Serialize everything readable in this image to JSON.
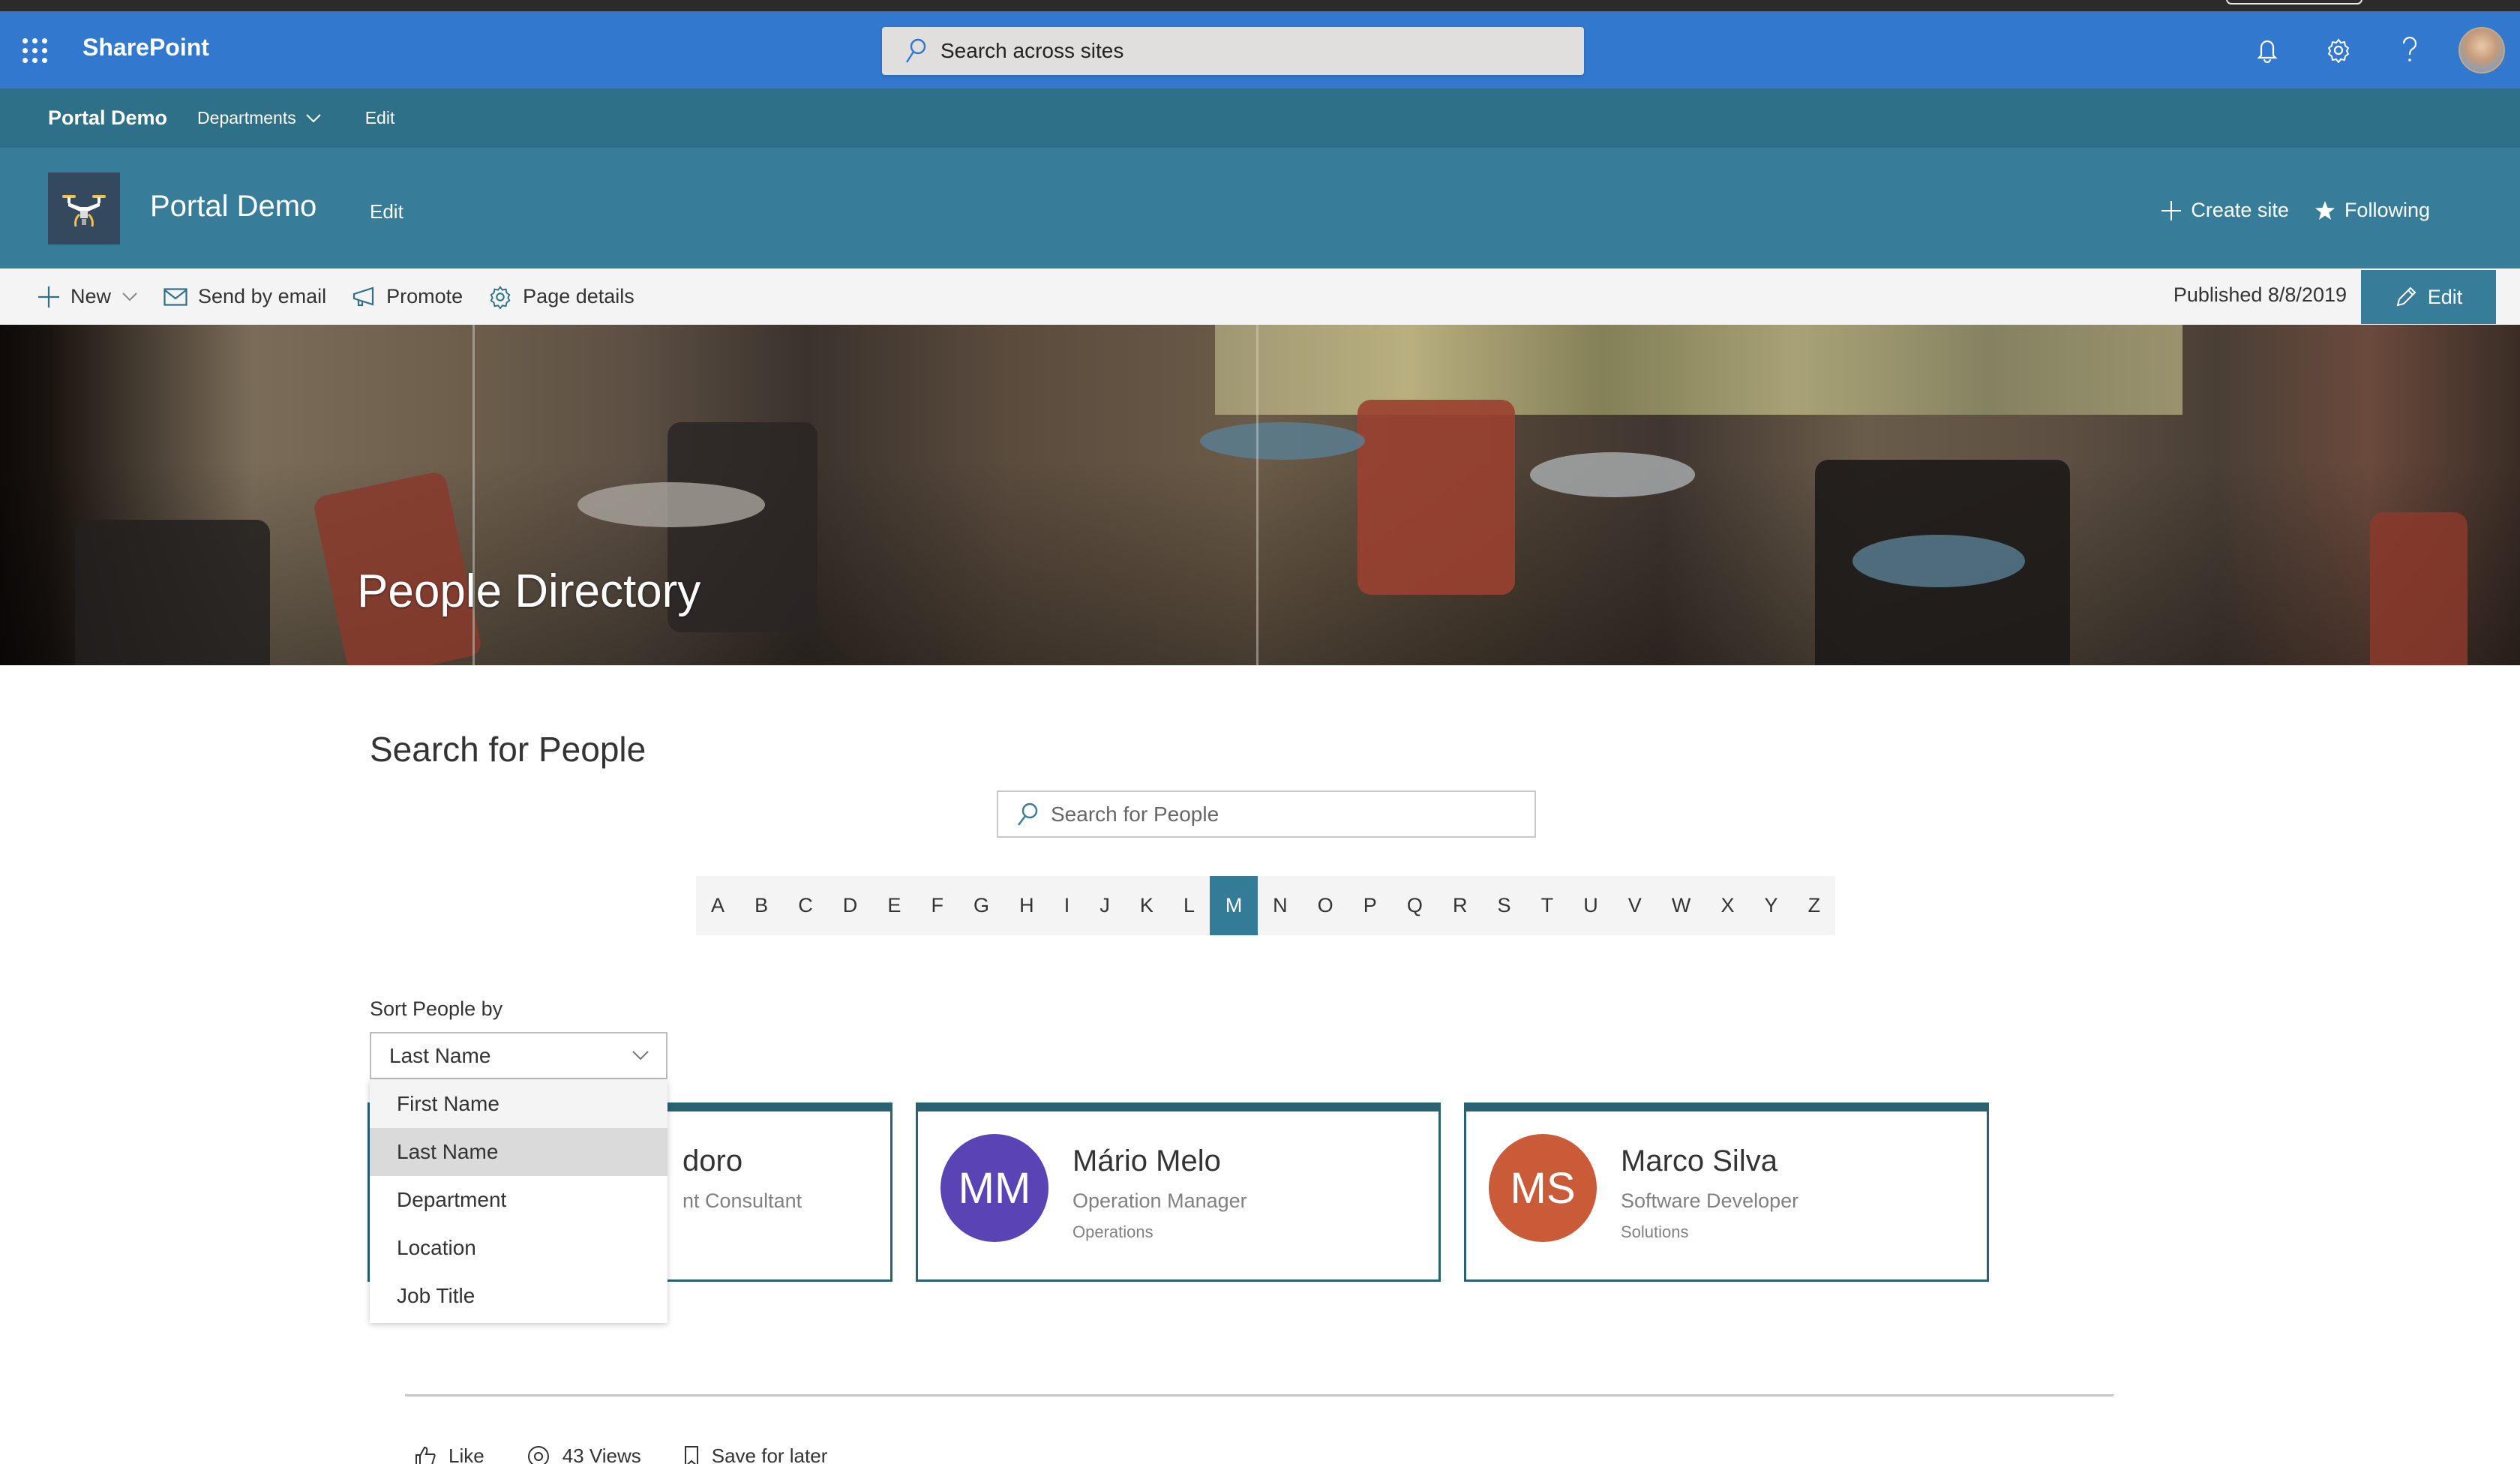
{
  "suite": {
    "app_name": "SharePoint",
    "search_placeholder": "Search across sites",
    "icons": [
      "waffle-icon",
      "bell-icon",
      "gear-icon",
      "help-icon",
      "user-avatar"
    ]
  },
  "hubnav": {
    "title": "Portal Demo",
    "links": [
      {
        "label": "Departments",
        "has_dropdown": true
      },
      {
        "label": "Edit",
        "has_dropdown": false
      }
    ]
  },
  "site": {
    "title": "Portal Demo",
    "edit_label": "Edit",
    "actions": [
      {
        "label": "Create site",
        "icon": "plus-icon"
      },
      {
        "label": "Following",
        "icon": "star-icon"
      }
    ]
  },
  "commandbar": {
    "items": [
      {
        "label": "New",
        "icon": "plus-icon",
        "has_dropdown": true
      },
      {
        "label": "Send by email",
        "icon": "mail-icon"
      },
      {
        "label": "Promote",
        "icon": "megaphone-icon"
      },
      {
        "label": "Page details",
        "icon": "gear-icon"
      }
    ],
    "published": "Published 8/8/2019",
    "edit_label": "Edit"
  },
  "hero": {
    "title": "People Directory"
  },
  "directory": {
    "heading": "Search for People",
    "search_placeholder": "Search for People",
    "letters": [
      "A",
      "B",
      "C",
      "D",
      "E",
      "F",
      "G",
      "H",
      "I",
      "J",
      "K",
      "L",
      "M",
      "N",
      "O",
      "P",
      "Q",
      "R",
      "S",
      "T",
      "U",
      "V",
      "W",
      "X",
      "Y",
      "Z"
    ],
    "active_letter": "M",
    "sort": {
      "label": "Sort People by",
      "selected": "Last Name",
      "options": [
        "First Name",
        "Last Name",
        "Department",
        "Location",
        "Job Title"
      ],
      "hovered": "First Name"
    },
    "people": [
      {
        "initials": "",
        "name": "doro",
        "title": "nt Consultant",
        "department": "",
        "color": "#2a6274"
      },
      {
        "initials": "MM",
        "name": "Mário Melo",
        "title": "Operation Manager",
        "department": "Operations",
        "color": "#5a44b5"
      },
      {
        "initials": "MS",
        "name": "Marco Silva",
        "title": "Software Developer",
        "department": "Solutions",
        "color": "#c95b38"
      }
    ]
  },
  "footer": {
    "like_label": "Like",
    "views_label": "43 Views",
    "save_label": "Save for later"
  },
  "colors": {
    "suite_bar": "#3178ce",
    "hub_nav": "#2f7089",
    "site_header": "#377d9a",
    "accent": "#347b98",
    "card_border": "#2a6274"
  }
}
